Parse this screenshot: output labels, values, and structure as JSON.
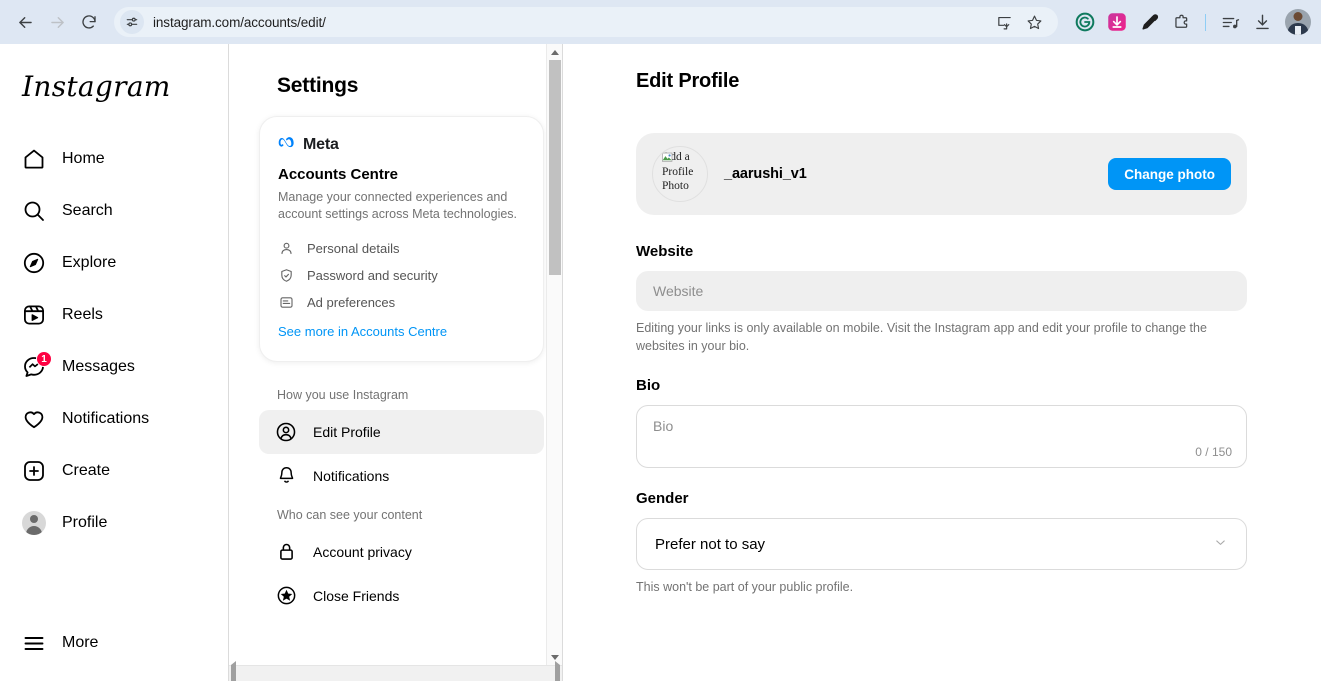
{
  "browser": {
    "back_label": "Back",
    "forward_label": "Forward",
    "reload_label": "Reload",
    "url": "instagram.com/accounts/edit/",
    "omnibox_icon": "tune-icon",
    "actions": [
      {
        "name": "install-app-icon",
        "label": "Install app"
      },
      {
        "name": "bookmark-star-icon",
        "label": "Bookmark"
      }
    ],
    "extensions": [
      {
        "name": "grammarly-extension-icon",
        "label": "Grammarly",
        "color": "#0f7a5e"
      },
      {
        "name": "video-downloader-extension-icon",
        "label": "Video Downloader",
        "color": "#e0289b"
      },
      {
        "name": "color-picker-extension-icon",
        "label": "Color picker"
      },
      {
        "name": "extensions-puzzle-icon",
        "label": "Extensions"
      }
    ],
    "toolbar_right": [
      {
        "name": "reading-list-icon",
        "label": "Reading list"
      },
      {
        "name": "downloads-icon",
        "label": "Downloads"
      }
    ],
    "profile_avatar_label": "Chrome profile"
  },
  "sidebar": {
    "logo": "Instagram",
    "items": [
      {
        "label": "Home",
        "icon": "home-icon"
      },
      {
        "label": "Search",
        "icon": "search-icon"
      },
      {
        "label": "Explore",
        "icon": "compass-icon"
      },
      {
        "label": "Reels",
        "icon": "reels-icon"
      },
      {
        "label": "Messages",
        "icon": "messenger-icon",
        "badge": "1"
      },
      {
        "label": "Notifications",
        "icon": "heart-icon"
      },
      {
        "label": "Create",
        "icon": "plus-square-icon"
      },
      {
        "label": "Profile",
        "icon": "avatar-icon"
      }
    ],
    "more": {
      "label": "More",
      "icon": "hamburger-menu-icon"
    }
  },
  "settings": {
    "title": "Settings",
    "meta_card": {
      "brand": "Meta",
      "brand_icon": "meta-infinity-icon",
      "heading": "Accounts Centre",
      "description": "Manage your connected experiences and account settings across Meta technologies.",
      "links": [
        {
          "label": "Personal details",
          "icon": "person-icon"
        },
        {
          "label": "Password and security",
          "icon": "shield-check-icon"
        },
        {
          "label": "Ad preferences",
          "icon": "ad-preferences-icon"
        }
      ],
      "see_more": "See more in Accounts Centre"
    },
    "groups": [
      {
        "label": "How you use Instagram",
        "items": [
          {
            "label": "Edit Profile",
            "icon": "profile-circle-icon",
            "active": true
          },
          {
            "label": "Notifications",
            "icon": "bell-icon",
            "active": false
          }
        ]
      },
      {
        "label": "Who can see your content",
        "items": [
          {
            "label": "Account privacy",
            "icon": "lock-icon",
            "active": false
          },
          {
            "label": "Close Friends",
            "icon": "star-circle-icon",
            "active": false
          }
        ]
      }
    ]
  },
  "main": {
    "title": "Edit Profile",
    "photo_card": {
      "avatar_alt": "Add a Profile Photo",
      "avatar_alt_display": "Add a\nProfile\nPhoto",
      "username": "_aarushi_v1",
      "change_photo_label": "Change photo",
      "button_color": "#0095F6"
    },
    "website": {
      "label": "Website",
      "placeholder": "Website",
      "value": "",
      "helper": "Editing your links is only available on mobile. Visit the Instagram app and edit your profile to change the websites in your bio."
    },
    "bio": {
      "label": "Bio",
      "placeholder": "Bio",
      "value": "",
      "counter": "0 / 150"
    },
    "gender": {
      "label": "Gender",
      "selected": "Prefer not to say",
      "helper": "This won't be part of your public profile."
    }
  }
}
